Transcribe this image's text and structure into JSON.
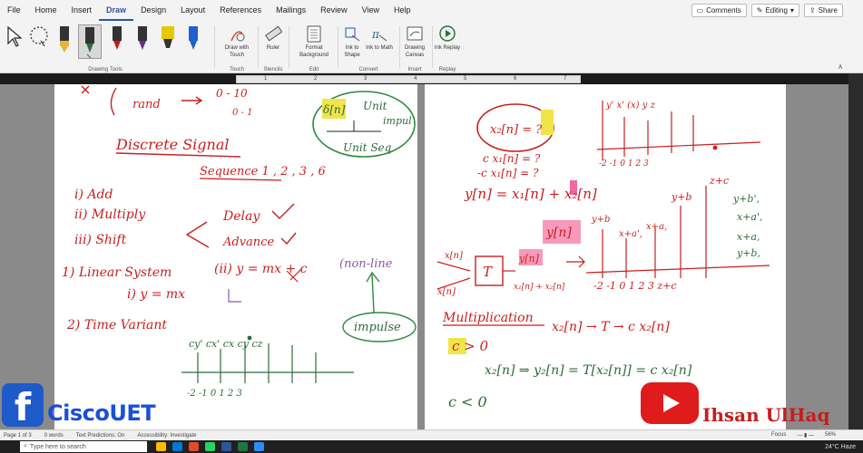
{
  "menu": {
    "tabs": [
      "File",
      "Home",
      "Insert",
      "Draw",
      "Design",
      "Layout",
      "References",
      "Mailings",
      "Review",
      "View",
      "Help"
    ],
    "active_tab": "Draw",
    "comments": "Comments",
    "editing": "Editing",
    "share": "Share"
  },
  "ribbon": {
    "group_drawing_tools": "Drawing Tools",
    "draw_with_touch": "Draw with Touch",
    "group_touch": "Touch",
    "ruler": "Ruler",
    "group_stencils": "Stencils",
    "format_background": "Format Background",
    "group_edit": "Edit",
    "ink_to_shape": "Ink to Shape",
    "ink_to_math": "Ink to Math",
    "group_convert": "Convert",
    "drawing_canvas": "Drawing Canvas",
    "group_insert": "Insert",
    "ink_replay": "Ink Replay",
    "group_replay": "Replay",
    "pen_colors": [
      "#1f1f1f",
      "#2d6b3a",
      "#d01818",
      "#6a2a8a",
      "#e6c800",
      "#1f5fd0"
    ]
  },
  "ruler_numbers": [
    "1",
    "2",
    "3",
    "4",
    "5",
    "6",
    "7"
  ],
  "status": {
    "page": "Page 1 of 3",
    "words": "0 words",
    "predictions": "Text Predictions: On",
    "accessibility": "Accessibility: Investigate",
    "focus": "Focus",
    "zoom": "56%"
  },
  "taskbar": {
    "search_placeholder": "Type here to search",
    "weather": "24°C Haze"
  },
  "overlay": {
    "fb_letter": "f",
    "left_brand": "CiscoUET",
    "right_brand": "Ihsan UlHaq"
  },
  "notes": {
    "p1": {
      "rand": "rand",
      "range1": "0 - 10",
      "range2": "0 - 1",
      "unit_left": "δ[n]",
      "unit_r1": "Unit",
      "unit_r2": "impul",
      "unit_r3": "Unit Seq",
      "title": "Discrete Signal",
      "sequence": "Sequence  1 , 2 , 3 , 6",
      "op1": "i) Add",
      "op2": "ii) Multiply",
      "op3": "iii) Shift",
      "delay": "Delay",
      "advance": "Advance",
      "linear": "1) Linear System",
      "ii_eq": "(ii) y = mx + c",
      "i_eq": "i) y = mx",
      "nonlinear": "(non-line",
      "time_var": "2) Time Variant",
      "impulse": "impulse",
      "stem_labels": "cy'  cx'  cx     cy   cz",
      "axis": "-2  -1   0    1    2    3"
    },
    "p2": {
      "x2n": "x₂[n] = ?",
      "cx1": "c x₁[n] = ?",
      "mcx1": "-c x₁[n] = ?",
      "yn_sum": "y[n] = x₁[n] + x₂[n]",
      "yb": "y+b",
      "zc": "z+c",
      "ynbox": "y[n]",
      "right1": "y+b',",
      "right2": "x+a',",
      "right3": "x+a,",
      "right4": "y+b,",
      "xn": "x[n]",
      "tbox": "T",
      "sum_out": "x₁[n] + x₂[n]",
      "axis": "-2   -1    0    1    2    3    z+c",
      "top_labels": "y'   x'  (x)  y   z",
      "top_axis": "-2  -1   0   1   2   3",
      "mult": "Multiplication",
      "mult_eq": "x₂[n] → T → c x₂[n]",
      "cgt": "c > 0",
      "final": "x₂[n] ⇒ y₂[n] = T[x₂[n]] = c x₂[n]",
      "clt": "c < 0"
    }
  }
}
